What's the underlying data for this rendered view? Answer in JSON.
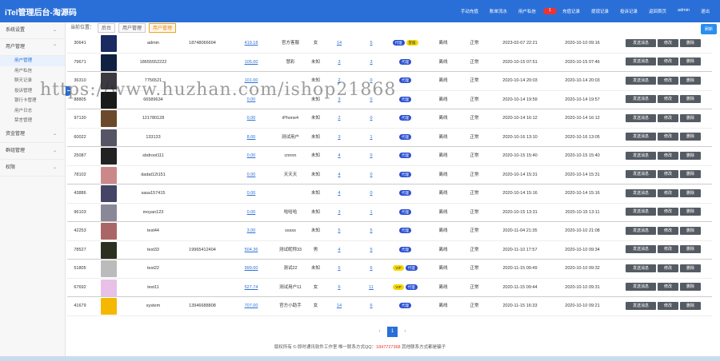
{
  "app": {
    "title": "iTel管理后台-淘源码"
  },
  "topnav": [
    {
      "label": "手动充值"
    },
    {
      "label": "账单流水"
    },
    {
      "label": "用户私信",
      "badge": "1"
    },
    {
      "label": "充值记录"
    },
    {
      "label": "提现记录"
    },
    {
      "label": "投诉记录"
    },
    {
      "label": "返回首页"
    },
    {
      "label": "admin"
    },
    {
      "label": "退出"
    }
  ],
  "refresh_label": "刷新",
  "sidebar": {
    "groups": [
      {
        "label": "系统设置",
        "chev": "⌄",
        "items": []
      },
      {
        "label": "用户管理",
        "chev": "⌃",
        "items": [
          {
            "label": "用户管理",
            "active": true
          },
          {
            "label": "用户私信",
            "active": false
          },
          {
            "label": "聊天记录",
            "active": false
          },
          {
            "label": "投诉管理",
            "active": false
          },
          {
            "label": "银行卡管理",
            "active": false
          },
          {
            "label": "用户日志",
            "active": false
          },
          {
            "label": "禁言管理",
            "active": false
          }
        ]
      },
      {
        "label": "资金管理",
        "chev": "⌄",
        "items": []
      },
      {
        "label": "群组管理",
        "chev": "⌄",
        "items": []
      },
      {
        "label": "权限",
        "chev": "⌄",
        "items": []
      }
    ]
  },
  "breadcrumb": {
    "prefix": "当前位置：",
    "items": [
      "后台",
      "用户管理",
      "用户管理"
    ]
  },
  "watermark": "https://www.huzhan.com/ishop21868",
  "actions": {
    "send": "发送消息",
    "edit": "修改",
    "delete": "删除"
  },
  "avatar_colors": [
    "#1b2a60",
    "#102040",
    "#3a3a40",
    "#1a1a1a",
    "#6a4a2a",
    "#556",
    "#222",
    "#c88",
    "#446",
    "#889",
    "#a66",
    "#2b3020",
    "#bbb",
    "#e8c0e8",
    "#f5b800"
  ],
  "rows": [
    {
      "id": "30641",
      "user": "admin",
      "phone": "18748066604",
      "bal": "419.18",
      "nick": "官方客服",
      "sex": "女",
      "a": "14",
      "b": "5",
      "tags": [
        "代理",
        "客服"
      ],
      "online": "离线",
      "status": "正常",
      "t1": "2023-02-07 22:21",
      "t2": "2020-10-10 09:16",
      "sep": false
    },
    {
      "id": "79671",
      "user": "18655552222",
      "phone": "",
      "bal": "105.00",
      "nick": "慧彩",
      "sex": "未知",
      "a": "3",
      "b": "3",
      "tags": [
        "代理"
      ],
      "online": "离线",
      "status": "正常",
      "t1": "2020-10-15 07:51",
      "t2": "2020-10-15 07:46",
      "sep": true
    },
    {
      "id": "36310",
      "user": "7756521",
      "phone": "",
      "bal": "101.00",
      "nick": "",
      "sex": "未知",
      "a": "2",
      "b": "0",
      "tags": [
        "代理"
      ],
      "online": "离线",
      "status": "正常",
      "t1": "2020-10-14 20:03",
      "t2": "2020-10-14 20:03",
      "sep": false
    },
    {
      "id": "88805",
      "user": "66589634",
      "phone": "",
      "bal": "0.00",
      "nick": "",
      "sex": "未知",
      "a": "3",
      "b": "0",
      "tags": [
        "代理"
      ],
      "online": "离线",
      "status": "正常",
      "t1": "2020-10-14 19:59",
      "t2": "2020-10-14 19:57",
      "sep": true
    },
    {
      "id": "97130",
      "user": "121780128",
      "phone": "",
      "bal": "0.00",
      "nick": "iPhone4",
      "sex": "未知",
      "a": "2",
      "b": "0",
      "tags": [
        "代理"
      ],
      "online": "离线",
      "status": "正常",
      "t1": "2020-10-14 16:12",
      "t2": "2020-10-14 16:12",
      "sep": false
    },
    {
      "id": "60022",
      "user": "133133",
      "phone": "",
      "bal": "8.00",
      "nick": "测试用户",
      "sex": "未知",
      "a": "3",
      "b": "1",
      "tags": [
        "代理"
      ],
      "online": "离线",
      "status": "正常",
      "t1": "2020-10-16 13:10",
      "t2": "2020-10-16 13:05",
      "sep": true
    },
    {
      "id": "25087",
      "user": "sbdroot111",
      "phone": "",
      "bal": "0.00",
      "nick": "cnnnn",
      "sex": "未知",
      "a": "4",
      "b": "0",
      "tags": [
        "代理"
      ],
      "online": "离线",
      "status": "正常",
      "t1": "2020-10-15 15:40",
      "t2": "2020-10-15 15:40",
      "sep": false
    },
    {
      "id": "78102",
      "user": "dadat12t151",
      "phone": "",
      "bal": "0.00",
      "nick": "天天天",
      "sex": "未知",
      "a": "4",
      "b": "0",
      "tags": [
        "代理"
      ],
      "online": "离线",
      "status": "正常",
      "t1": "2020-10-14 15:31",
      "t2": "2020-10-14 15:31",
      "sep": true
    },
    {
      "id": "43886",
      "user": "sasa157415",
      "phone": "",
      "bal": "0.00",
      "nick": "",
      "sex": "未知",
      "a": "4",
      "b": "0",
      "tags": [
        "代理"
      ],
      "online": "离线",
      "status": "正常",
      "t1": "2020-10-14 15:16",
      "t2": "2020-10-14 15:16",
      "sep": false
    },
    {
      "id": "96103",
      "user": "moyan123",
      "phone": "",
      "bal": "0.00",
      "nick": "哈哈哈",
      "sex": "未知",
      "a": "3",
      "b": "1",
      "tags": [
        "代理"
      ],
      "online": "离线",
      "status": "正常",
      "t1": "2020-10-15 13:31",
      "t2": "2020-10-15 13:11",
      "sep": true
    },
    {
      "id": "42253",
      "user": "test44",
      "phone": "",
      "bal": "3.00",
      "nick": "sssss",
      "sex": "未知",
      "a": "5",
      "b": "5",
      "tags": [
        "代理"
      ],
      "online": "离线",
      "status": "正常",
      "t1": "2020-11-04 21:35",
      "t2": "2020-10-10 21:08",
      "sep": false
    },
    {
      "id": "78527",
      "user": "test33",
      "phone": "19965412404",
      "bal": "504.36",
      "nick": "测试昵称33",
      "sex": "男",
      "a": "4",
      "b": "5",
      "tags": [
        "代理"
      ],
      "online": "离线",
      "status": "正常",
      "t1": "2020-11-10 17:57",
      "t2": "2020-10-10 09:34",
      "sep": true
    },
    {
      "id": "51805",
      "user": "test22",
      "phone": "",
      "bal": "999.00",
      "nick": "测试22",
      "sex": "未知",
      "a": "5",
      "b": "6",
      "tags": [
        "VIP",
        "代理"
      ],
      "online": "离线",
      "status": "正常",
      "t1": "2020-11-15 09:49",
      "t2": "2020-10-10 09:32",
      "sep": false
    },
    {
      "id": "67692",
      "user": "test11",
      "phone": "",
      "bal": "527.74",
      "nick": "测试用户11",
      "sex": "女",
      "a": "6",
      "b": "11",
      "tags": [
        "VIP",
        "代理"
      ],
      "online": "离线",
      "status": "正常",
      "t1": "2020-11-15 09:44",
      "t2": "2020-10-10 09:31",
      "sep": true
    },
    {
      "id": "41679",
      "user": "system",
      "phone": "13946688808",
      "bal": "707.00",
      "nick": "官方小助手",
      "sex": "女",
      "a": "14",
      "b": "6",
      "tags": [
        "代理"
      ],
      "online": "离线",
      "status": "正常",
      "t1": "2020-11-15 16:33",
      "t2": "2020-10-10 09:21",
      "sep": false
    }
  ],
  "pager": {
    "prev": "‹",
    "current": "1",
    "next": "›"
  },
  "footer": {
    "text1": "版权所有 © 即时通讯软件工作室 唯一联系方式QQ：",
    "qq": "1847727368",
    "text2": " 其他联系方式都是骗子"
  }
}
